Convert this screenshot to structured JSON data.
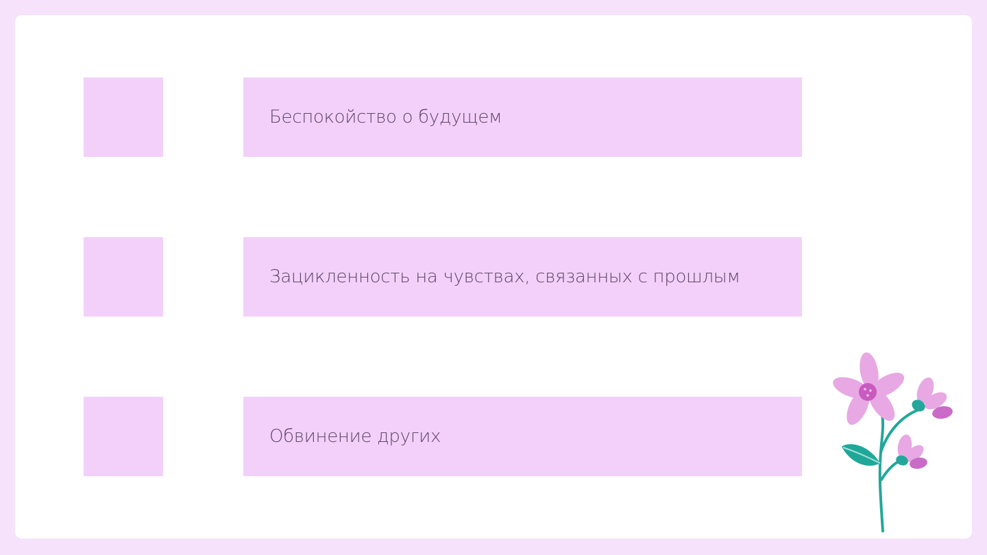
{
  "list": {
    "items": [
      {
        "text": "Беспокойство о будущем"
      },
      {
        "text": "Зацикленность на чувствах, связанных с прошлым"
      },
      {
        "text": "Обвинение других"
      }
    ]
  },
  "decoration": {
    "icon": "flower-illustration",
    "colors": {
      "petal": "#e7a8e4",
      "petal_dark": "#c96bc7",
      "center": "#c95bc0",
      "stem": "#22a79a",
      "leaf": "#1fa89a"
    }
  },
  "colors": {
    "background": "#f6e2fa",
    "card": "#ffffff",
    "box": "#f3d0fa",
    "text": "#5d4668"
  }
}
